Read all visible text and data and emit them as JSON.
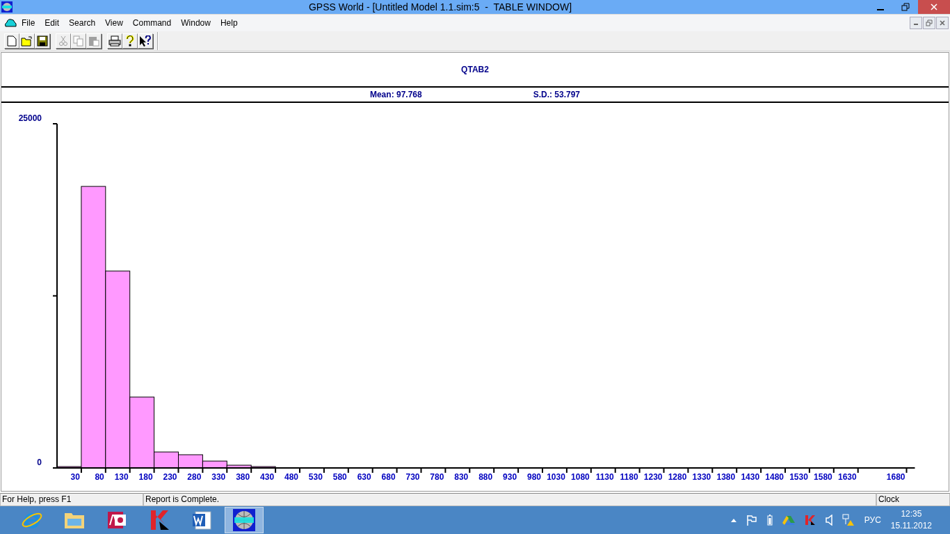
{
  "window": {
    "title": "GPSS World - [Untitled Model 1.1.sim:5  -  TABLE WINDOW]"
  },
  "menu": [
    "File",
    "Edit",
    "Search",
    "View",
    "Command",
    "Window",
    "Help"
  ],
  "toolbar": [
    {
      "kind": "new",
      "disabled": false
    },
    {
      "kind": "open",
      "disabled": false
    },
    {
      "kind": "save",
      "disabled": false
    },
    {
      "kind": "cut",
      "disabled": true
    },
    {
      "kind": "copy",
      "disabled": true
    },
    {
      "kind": "paste",
      "disabled": true
    },
    {
      "kind": "print",
      "disabled": false
    },
    {
      "kind": "help",
      "disabled": false
    },
    {
      "kind": "context-help",
      "disabled": false
    }
  ],
  "table": {
    "title": "QTAB2",
    "mean": "Mean: 97.768",
    "sd": "S.D.: 53.797",
    "chart_data": {
      "type": "bar",
      "ylim": [
        0,
        25000
      ],
      "yticks": [
        0,
        25000
      ],
      "categories": [
        "30",
        "80",
        "130",
        "180",
        "230",
        "280",
        "330",
        "380",
        "430",
        "480",
        "530",
        "580",
        "630",
        "680",
        "730",
        "780",
        "830",
        "880",
        "930",
        "980",
        "1030",
        "1080",
        "1130",
        "1180",
        "1230",
        "1280",
        "1330",
        "1380",
        "1430",
        "1480",
        "1530",
        "1580",
        "1630",
        "1680"
      ],
      "values": [
        100,
        20450,
        14300,
        5150,
        1160,
        960,
        500,
        200,
        100,
        0,
        0,
        0,
        0,
        0,
        0,
        0,
        0,
        0,
        0,
        0,
        0,
        0,
        0,
        0,
        0,
        0,
        0,
        0,
        0,
        0,
        0,
        0,
        0,
        0
      ]
    }
  },
  "status_bar": [
    "For Help, press F1",
    "Report is Complete.",
    "Clock"
  ],
  "taskbar": {
    "apps": [
      {
        "kind": "ie",
        "selected": false
      },
      {
        "kind": "explorer",
        "selected": false
      },
      {
        "kind": "access",
        "selected": false
      },
      {
        "kind": "kaspersky",
        "selected": false
      },
      {
        "kind": "word",
        "selected": false
      },
      {
        "kind": "gpss",
        "selected": true
      }
    ],
    "language": "РУС",
    "time": "12:35",
    "date": "15.11.2012"
  }
}
